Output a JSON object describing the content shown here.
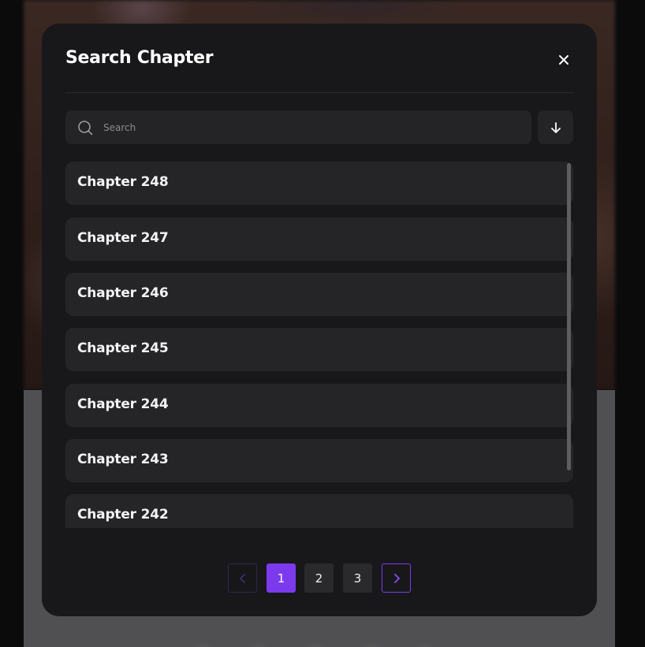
{
  "modal": {
    "title": "Search Chapter"
  },
  "search": {
    "placeholder": "Search",
    "value": ""
  },
  "chapters": [
    {
      "label": "Chapter 248"
    },
    {
      "label": "Chapter 247"
    },
    {
      "label": "Chapter 246"
    },
    {
      "label": "Chapter 245"
    },
    {
      "label": "Chapter 244"
    },
    {
      "label": "Chapter 243"
    },
    {
      "label": "Chapter 242"
    }
  ],
  "pagination": {
    "pages": [
      "1",
      "2",
      "3"
    ],
    "current": "1"
  },
  "icons": {
    "close": "close-icon",
    "search": "search-icon",
    "sort": "arrow-down-icon",
    "prev": "chevron-left-icon",
    "next": "chevron-right-icon"
  },
  "colors": {
    "accent": "#7c3aed",
    "modal_bg": "#18181b",
    "item_bg": "#252528"
  }
}
